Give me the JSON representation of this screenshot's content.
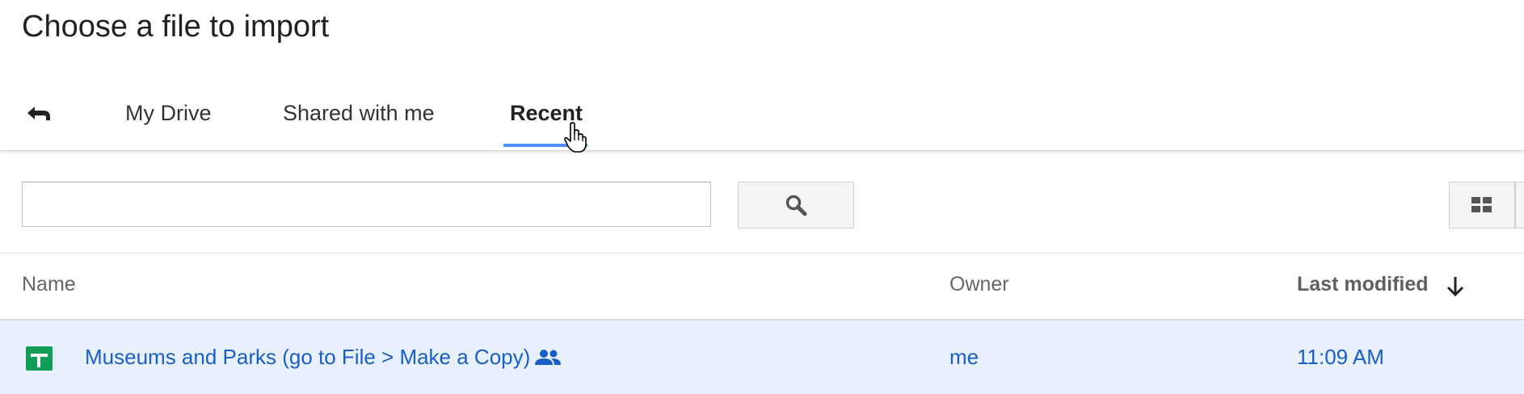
{
  "dialog": {
    "title": "Choose a file to import"
  },
  "tabs": [
    {
      "label": "My Drive",
      "active": false
    },
    {
      "label": "Shared with me",
      "active": false
    },
    {
      "label": "Recent",
      "active": true
    }
  ],
  "search": {
    "value": "",
    "placeholder": "",
    "button_icon": "search-icon"
  },
  "view_toggle_icon": "grid-view-icon",
  "table": {
    "columns": {
      "name": "Name",
      "owner": "Owner",
      "last_modified": "Last modified"
    },
    "sort": {
      "column": "last_modified",
      "direction": "descending",
      "icon": "arrow-down-icon"
    },
    "rows": [
      {
        "name": "Museums and Parks (go to File > Make a Copy)",
        "type_icon": "google-sheets-icon",
        "shared": true,
        "owner": "me",
        "last_modified": "11:09 AM",
        "selected": true
      }
    ]
  },
  "colors": {
    "accent": "#4d90fe",
    "link": "#1a5fc7",
    "row_selected": "#e8f0fd",
    "sheets_green": "#0f9d58"
  }
}
